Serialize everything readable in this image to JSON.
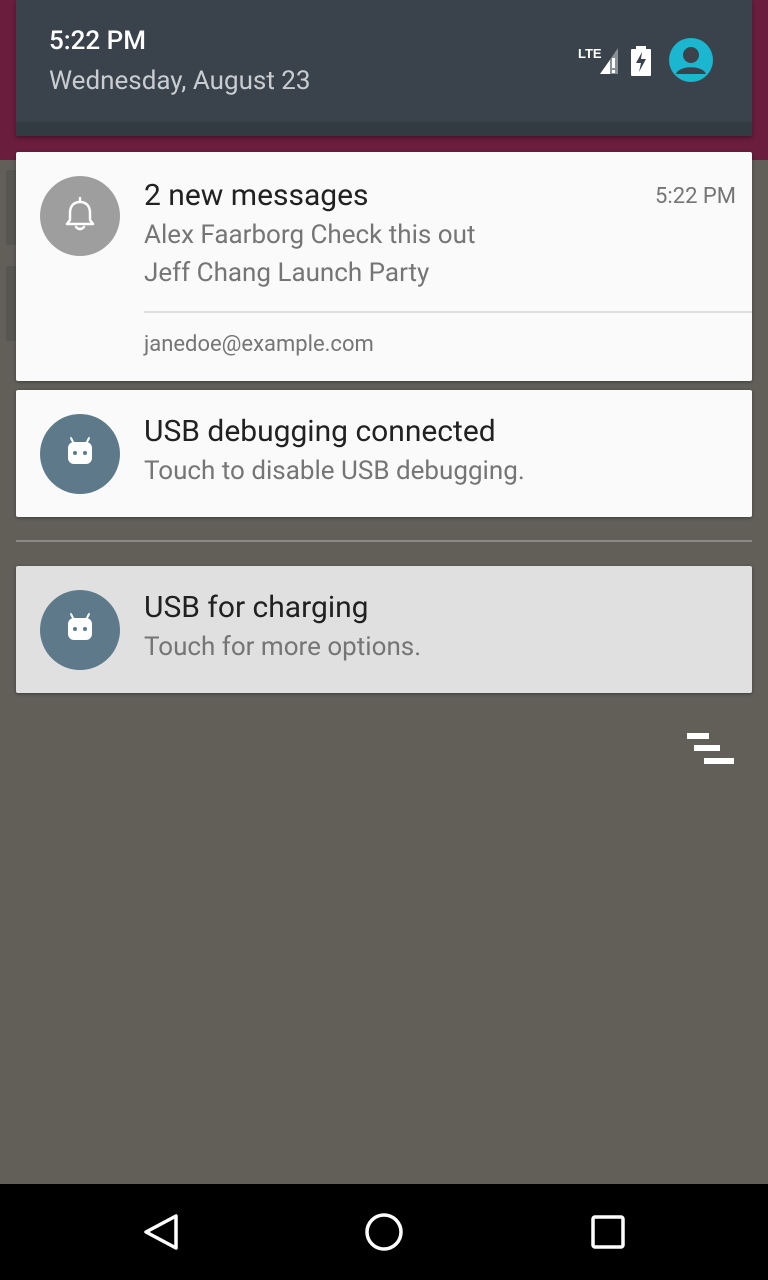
{
  "status": {
    "time": "5:22 PM",
    "date": "Wednesday, August 23",
    "network_label": "LTE",
    "icons": [
      "lte-signal-icon",
      "battery-charging-icon",
      "user-avatar-icon"
    ]
  },
  "notifications": [
    {
      "icon": "bell-icon",
      "title": "2 new messages",
      "time": "5:22 PM",
      "lines": [
        "Alex Faarborg Check this out",
        "Jeff Chang Launch Party"
      ],
      "account": "janedoe@example.com"
    },
    {
      "icon": "android-icon",
      "title": "USB debugging connected",
      "text": "Touch to disable USB debugging."
    },
    {
      "icon": "android-icon",
      "title": "USB for charging",
      "text": "Touch for more options."
    }
  ],
  "actions": {
    "overflow_icon": "clear-all-icon"
  },
  "navigation": {
    "back": "back-icon",
    "home": "home-icon",
    "recents": "recents-icon"
  },
  "colors": {
    "shade_header": "#3a434c",
    "scrim": "#615f58",
    "accent_user": "#1bb7d0",
    "bell_avatar": "#9e9e9e",
    "android_avatar": "#5e7a8a"
  }
}
